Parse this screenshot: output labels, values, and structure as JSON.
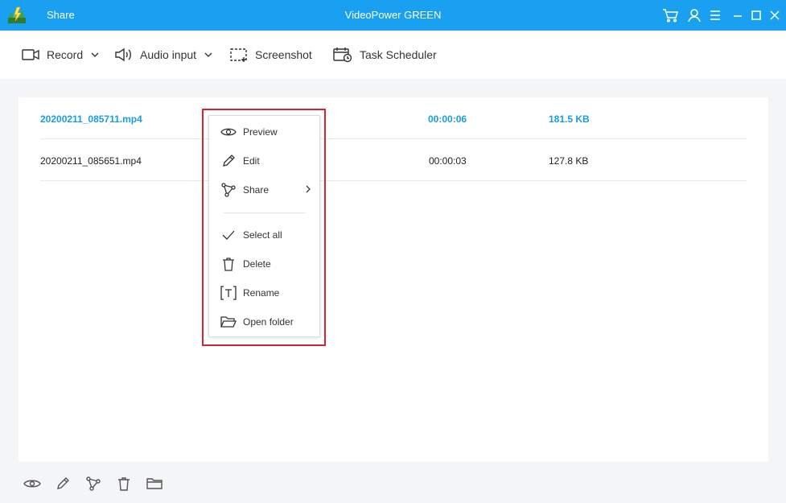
{
  "titlebar": {
    "share_label": "Share",
    "app_title": "VideoPower GREEN",
    "accent_color": "#1aa0f0",
    "icons": [
      "cart-icon",
      "user-icon",
      "menu-icon",
      "minimize-icon",
      "maximize-icon",
      "close-icon"
    ]
  },
  "toolbar": {
    "record_label": "Record",
    "audio_label": "Audio input",
    "screenshot_label": "Screenshot",
    "scheduler_label": "Task Scheduler"
  },
  "files": [
    {
      "name": "20200211_085711.mp4",
      "duration": "00:00:06",
      "size": "181.5 KB",
      "selected": true
    },
    {
      "name": "20200211_085651.mp4",
      "duration": "00:00:03",
      "size": "127.8 KB",
      "selected": false
    }
  ],
  "context_menu": {
    "preview": "Preview",
    "edit": "Edit",
    "share": "Share",
    "select_all": "Select all",
    "delete": "Delete",
    "rename": "Rename",
    "open_folder": "Open folder",
    "highlight_color": "#d9232e"
  },
  "bottombar": {
    "icons": [
      "eye-icon",
      "pencil-icon",
      "share-icon",
      "trash-icon",
      "folder-icon"
    ]
  }
}
